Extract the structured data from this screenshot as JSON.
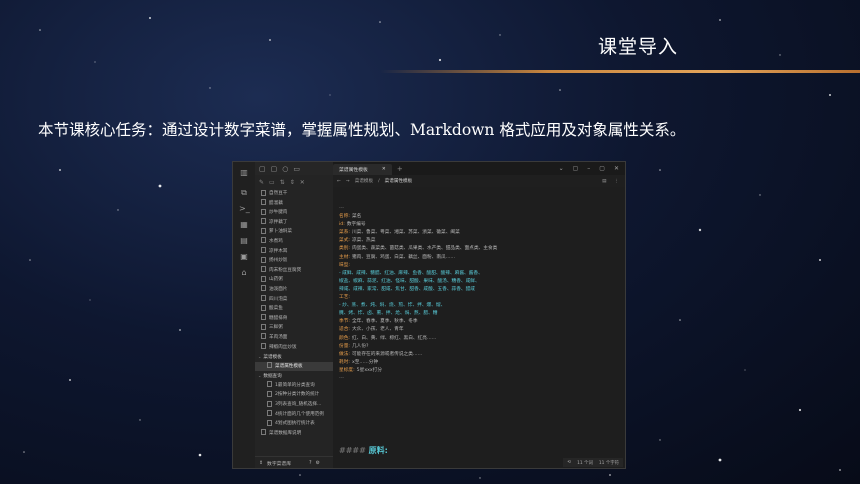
{
  "slide": {
    "title": "课堂导入",
    "subtitle": "本节课核心任务：通过设计数字菜谱，掌握属性规划、Markdown 格式应用及对象属性关系。"
  },
  "app": {
    "tab_title": "菜谱属性模板",
    "breadcrumb": [
      "菜谱模板",
      "菜谱属性模板"
    ],
    "sidebar_items": [
      {
        "label": "自然豆干",
        "kind": "file"
      },
      {
        "label": "醋溜藕",
        "kind": "file"
      },
      {
        "label": "炒牛腱肉",
        "kind": "file"
      },
      {
        "label": "凉拌藕丁",
        "kind": "file"
      },
      {
        "label": "萝卜油焖菜",
        "kind": "file"
      },
      {
        "label": "水煮鸡",
        "kind": "file"
      },
      {
        "label": "凉拌木耳",
        "kind": "file"
      },
      {
        "label": "扬州炒饭",
        "kind": "file"
      },
      {
        "label": "肉末粉丝豆腐煲",
        "kind": "file"
      },
      {
        "label": "山药粥",
        "kind": "file"
      },
      {
        "label": "油泼面片",
        "kind": "file"
      },
      {
        "label": "四川泡菜",
        "kind": "file"
      },
      {
        "label": "酸菜鱼",
        "kind": "file"
      },
      {
        "label": "糖醋排骨",
        "kind": "file"
      },
      {
        "label": "三鲜粥",
        "kind": "file"
      },
      {
        "label": "羊肉汤面",
        "kind": "file"
      },
      {
        "label": "辣椒肉丝炒饭",
        "kind": "file"
      },
      {
        "label": "菜谱模板",
        "kind": "folder"
      },
      {
        "label": "菜谱属性模板",
        "kind": "sub-active"
      },
      {
        "label": "数据查询",
        "kind": "folder"
      },
      {
        "label": "1最简单的分类查询",
        "kind": "sub"
      },
      {
        "label": "2按种分类计数的统计",
        "kind": "sub"
      },
      {
        "label": "3列表查询_随机选择...",
        "kind": "sub"
      },
      {
        "label": "4统计面的几个使用范例",
        "kind": "sub"
      },
      {
        "label": "4划式图执行统计表",
        "kind": "sub"
      },
      {
        "label": "菜谱数据库说明",
        "kind": "file"
      }
    ],
    "vault_name": "数字菜谱库",
    "content_lines": [
      {
        "key": "",
        "value": "---",
        "style": "dim"
      },
      {
        "key": "名称:",
        "value": "菜名",
        "style": "normal"
      },
      {
        "key": "id:",
        "value": "数字编号",
        "style": "normal"
      },
      {
        "key": "菜系:",
        "value": "川菜、鲁菜、粤菜、湘菜、苏菜、浙菜、徽菜、闽菜",
        "style": "normal"
      },
      {
        "key": "菜式:",
        "value": "凉菜、热菜",
        "style": "normal"
      },
      {
        "key": "类别:",
        "value": "肉蛋类、蔬菜类、菌菇类、瓜果类、水产类、甜品类、面点类、主食类",
        "style": "normal"
      },
      {
        "key": "主材:",
        "value": "猪肉、豆腐、鸡蛋、白菜、藕丝、面粉、南瓜……",
        "style": "normal"
      },
      {
        "key": "味型:",
        "value": "",
        "style": "normal"
      },
      {
        "key": "",
        "value": "  - 咸鲜、咸辣、糖醋、红油、麻辣、鱼香、酸甜、酸辣、麻酱、酱香、",
        "style": "cyan"
      },
      {
        "key": "",
        "value": "    椒盐、椒麻、蒜泥、红油、怪味、甜酸、果味、酸汤、糟香、咸鲜、",
        "style": "cyan"
      },
      {
        "key": "",
        "value": "    辣咸、咸辣、家常、甜咸、焦甘、甜香、咸酸、五香、蒜香、醋咸",
        "style": "cyan"
      },
      {
        "key": "工艺:",
        "value": "",
        "style": "normal"
      },
      {
        "key": "",
        "value": "  - 炒、蒸、煮、炖、焖、烧、煎、炸、拌、爆、熘、",
        "style": "cyan"
      },
      {
        "key": "",
        "value": "    腌、烤、炸、卤、熏、拌、炝、焗、熬、腊、糟",
        "style": "cyan"
      },
      {
        "key": "季节:",
        "value": "全年、春季、夏季、秋季、冬季",
        "style": "normal"
      },
      {
        "key": "适合:",
        "value": "大众、小孩、老人、青年",
        "style": "normal"
      },
      {
        "key": "颜色:",
        "value": "红、白、黄、绿、棕红、黑白、红亮……",
        "style": "normal"
      },
      {
        "key": "份量:",
        "value": "几人份?",
        "style": "normal"
      },
      {
        "key": "做法:",
        "value": "可能存在的来源或者传说之类……",
        "style": "normal"
      },
      {
        "key": "耗时:",
        "value": "x至……分钟",
        "style": "normal"
      },
      {
        "key": "星标度:",
        "value": "5星xxx打分",
        "style": "normal"
      },
      {
        "key": "",
        "value": "---",
        "style": "dim"
      }
    ],
    "section_heading_prefix": "####",
    "section_heading": "原料:",
    "status": {
      "lines": "11 个词",
      "chars": "11 个字符"
    }
  }
}
